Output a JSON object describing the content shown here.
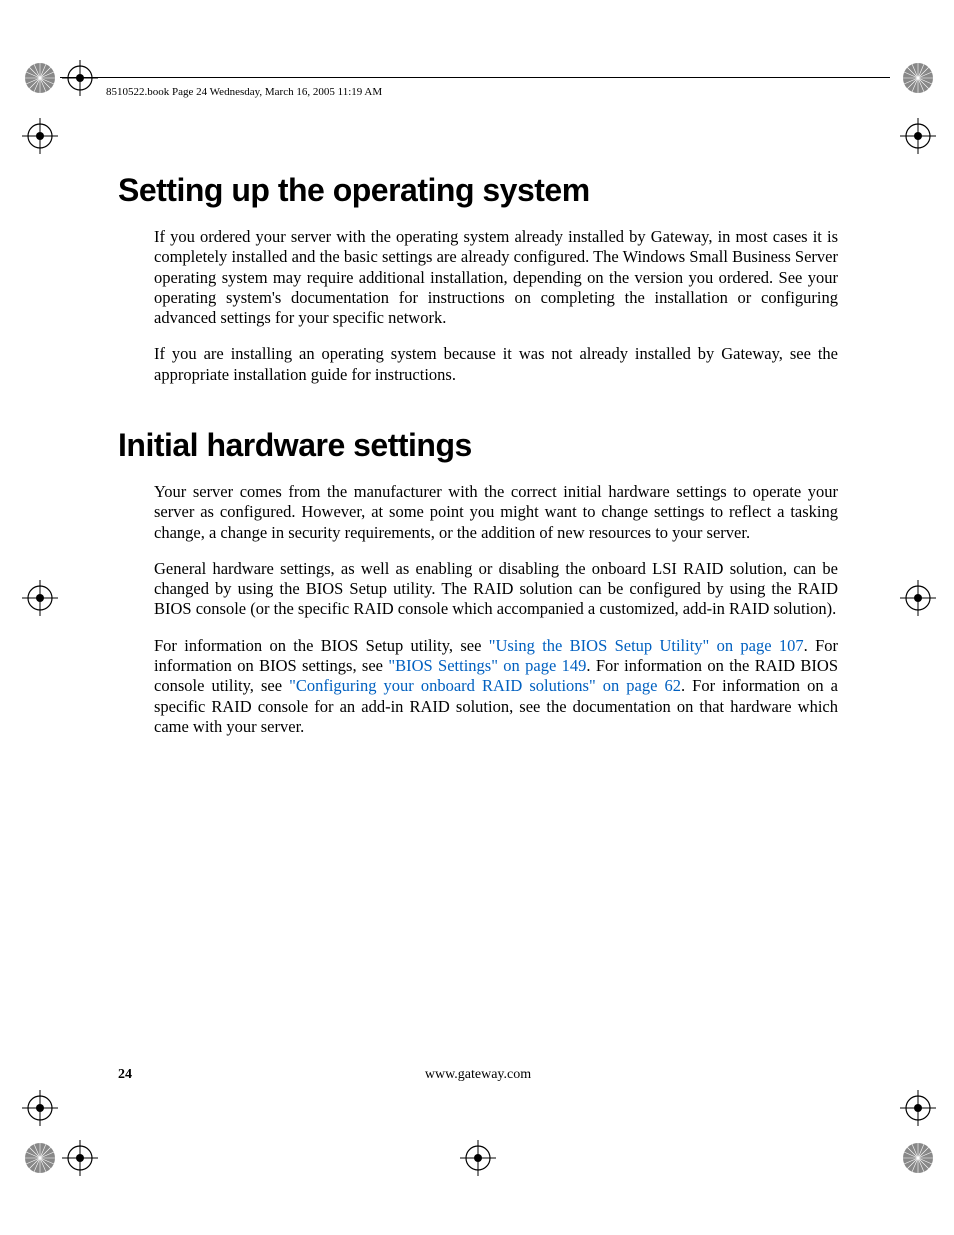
{
  "header_line": "8510522.book  Page 24  Wednesday, March 16, 2005  11:19 AM",
  "h1a": "Setting up the operating system",
  "p1": "If you ordered your server with the operating system already installed by Gateway, in most cases it is completely installed and the basic settings are already configured. The Windows Small Business Server operating system may require additional installation, depending on the version you ordered. See your operating system's documentation for instructions on completing the installation or configuring advanced settings for your specific network.",
  "p2": "If you are installing an operating system because it was not already installed by Gateway, see the appropriate installation guide for instructions.",
  "h1b": "Initial hardware settings",
  "p3": "Your server comes from the manufacturer with the correct initial hardware settings to operate your server as configured. However, at some point you might want to change settings to reflect a tasking change, a change in security requirements, or the addition of new resources to your server.",
  "p4": "General hardware settings, as well as enabling or disabling the onboard LSI RAID solution, can be changed by using the BIOS Setup utility. The RAID solution can be configured by using the RAID BIOS console (or the specific RAID console which accompanied a customized, add-in RAID solution).",
  "p5a": "For information on the BIOS Setup utility, see ",
  "link1": "\"Using the BIOS Setup Utility\" on page 107",
  "p5b": ". For information on BIOS settings, see ",
  "link2": "\"BIOS Settings\" on page 149",
  "p5c": ". For information on the RAID BIOS console utility, see ",
  "link3": "\"Configuring your onboard RAID solutions\" on page 62",
  "p5d": ". For information on a specific RAID console for an add-in RAID solution, see the documentation on that hardware which came with your server.",
  "page_number": "24",
  "footer_url": "www.gateway.com"
}
